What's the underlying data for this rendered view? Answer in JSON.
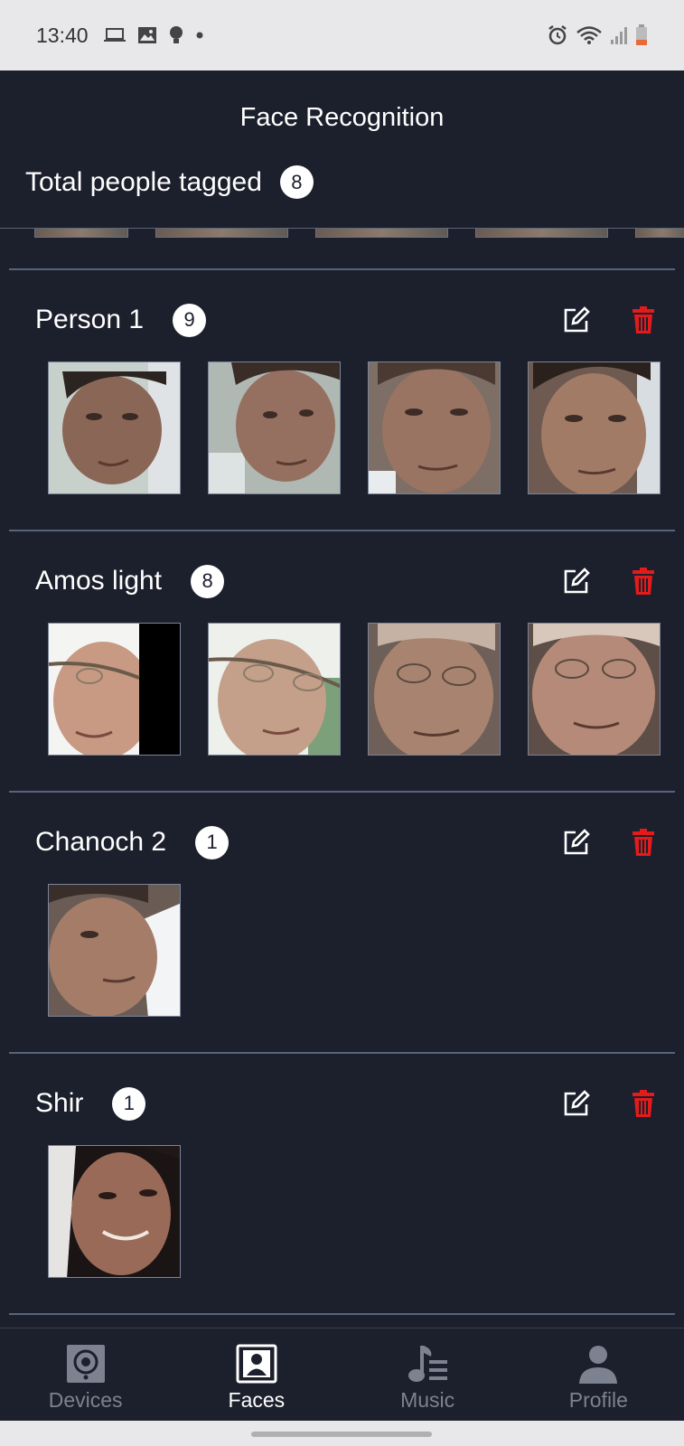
{
  "status_bar": {
    "time": "13:40"
  },
  "header": {
    "title": "Face Recognition",
    "total_label": "Total people tagged",
    "total_count": "8"
  },
  "people": [
    {
      "name": "Person 1",
      "count": "9"
    },
    {
      "name": "Amos light",
      "count": "8"
    },
    {
      "name": "Chanoch 2",
      "count": "1"
    },
    {
      "name": "Shir",
      "count": "1"
    }
  ],
  "nav": {
    "items": [
      {
        "label": "Devices",
        "icon": "speaker-icon"
      },
      {
        "label": "Faces",
        "icon": "portrait-icon"
      },
      {
        "label": "Music",
        "icon": "music-icon"
      },
      {
        "label": "Profile",
        "icon": "person-icon"
      }
    ],
    "active": "Faces"
  },
  "colors": {
    "background": "#1c1f2c",
    "divider": "#5a6478",
    "delete": "#e31b1b",
    "inactive_nav": "#7c8290"
  }
}
